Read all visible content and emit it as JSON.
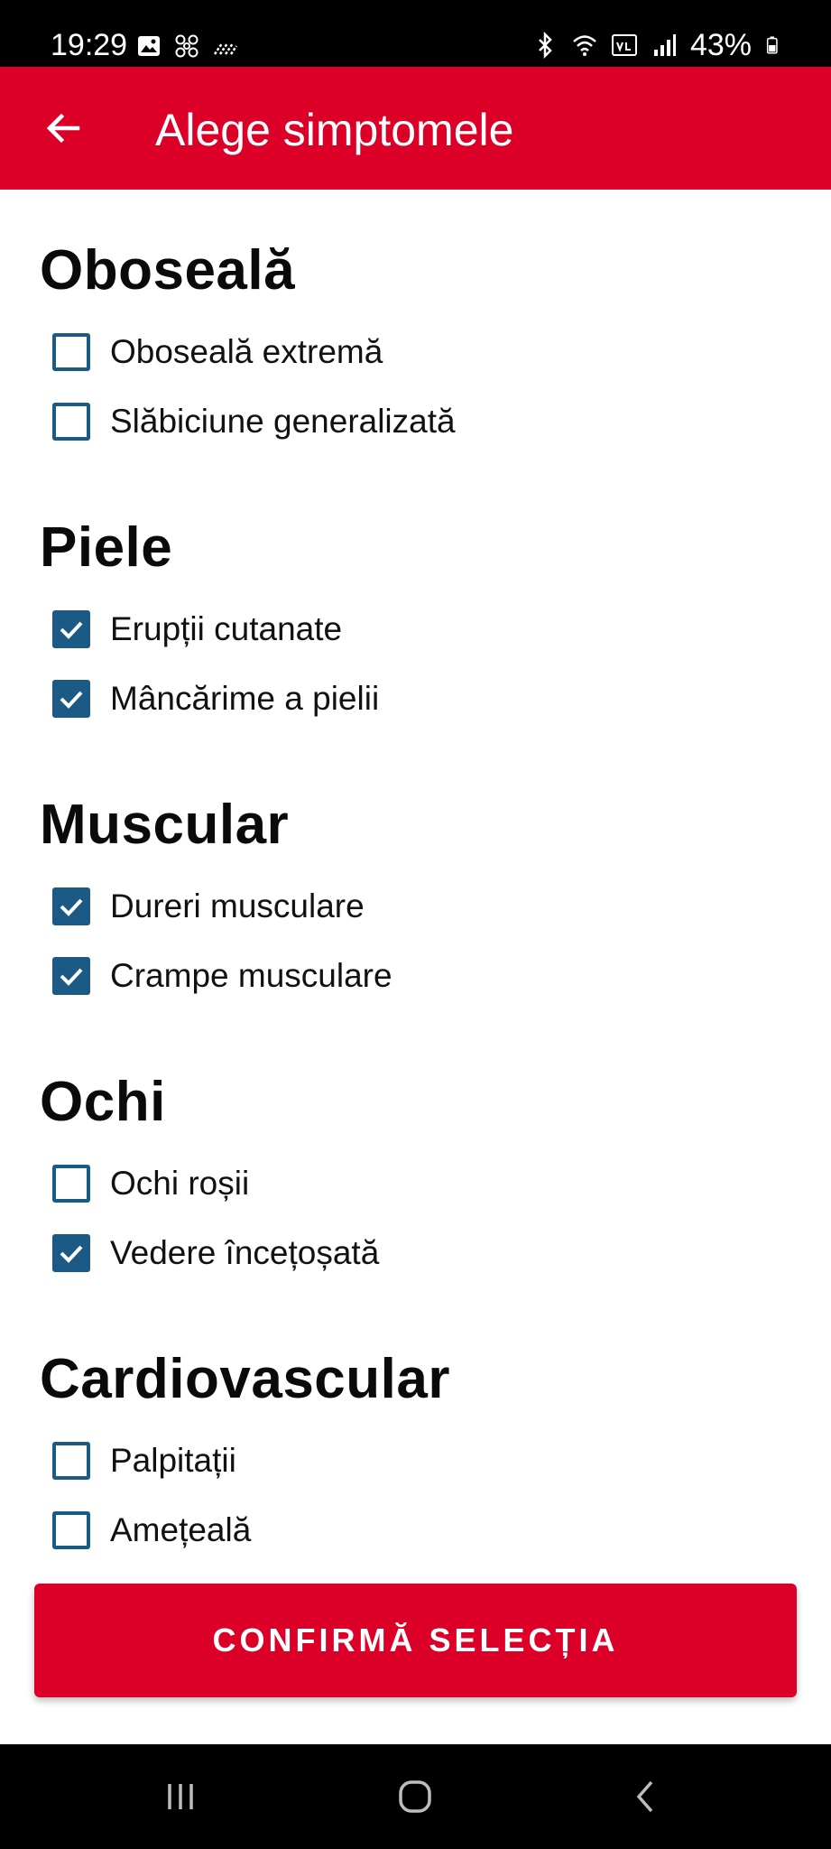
{
  "status_bar": {
    "time": "19:29",
    "battery": "43%",
    "icons": [
      "image-icon",
      "fan-icon",
      "signal-dots-icon",
      "bluetooth-icon",
      "wifi-icon",
      "volte-icon",
      "cell-signal-icon",
      "battery-icon"
    ]
  },
  "app_bar": {
    "title": "Alege simptomele",
    "back_icon": "arrow-left-icon",
    "color": "#DC0028"
  },
  "sections": [
    {
      "title": "Oboseală",
      "options": [
        {
          "label": "Oboseală extremă",
          "checked": false
        },
        {
          "label": "Slăbiciune generalizată",
          "checked": false
        }
      ]
    },
    {
      "title": "Piele",
      "options": [
        {
          "label": "Erupții cutanate",
          "checked": true
        },
        {
          "label": "Mâncărime a pielii",
          "checked": true
        }
      ]
    },
    {
      "title": "Muscular",
      "options": [
        {
          "label": "Dureri musculare",
          "checked": true
        },
        {
          "label": "Crampe musculare",
          "checked": true
        }
      ]
    },
    {
      "title": "Ochi",
      "options": [
        {
          "label": "Ochi roșii",
          "checked": false
        },
        {
          "label": "Vedere încețoșată",
          "checked": true
        }
      ]
    },
    {
      "title": "Cardiovascular",
      "options": [
        {
          "label": "Palpitații",
          "checked": false
        },
        {
          "label": "Amețeală",
          "checked": false
        }
      ]
    }
  ],
  "confirm_button": {
    "label": "CONFIRMĂ SELECȚIA"
  },
  "colors": {
    "accent": "#DC0028",
    "checkbox": "#1C5A86"
  },
  "nav_bar": {
    "icons": [
      "recents-icon",
      "home-icon",
      "back-icon"
    ]
  }
}
